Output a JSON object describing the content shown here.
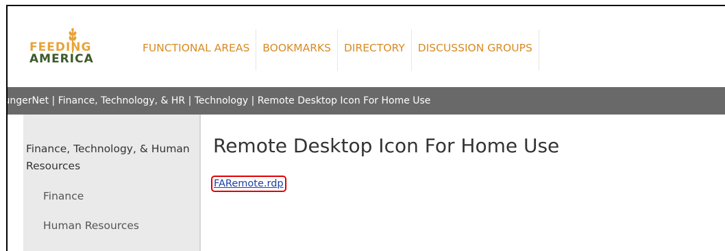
{
  "logo": {
    "line1": "FEEDING",
    "line2": "AMERICA",
    "icon": "wheat-icon"
  },
  "nav": {
    "items": [
      {
        "label": "FUNCTIONAL AREAS"
      },
      {
        "label": "BOOKMARKS"
      },
      {
        "label": "DIRECTORY"
      },
      {
        "label": "DISCUSSION GROUPS"
      }
    ]
  },
  "breadcrumb": {
    "text": "HungerNet | Finance, Technology, & HR | Technology | Remote Desktop Icon For Home Use"
  },
  "sidebar": {
    "heading": "Finance, Technology, & Human Resources",
    "items": [
      {
        "label": "Finance"
      },
      {
        "label": "Human Resources"
      }
    ]
  },
  "main": {
    "title": "Remote Desktop Icon For Home Use",
    "link_label": "FARemote.rdp"
  },
  "colors": {
    "nav_text": "#d98a22",
    "breadcrumb_bg": "#696969",
    "sidebar_bg": "#eaeaea",
    "link": "#1a3fa8",
    "highlight": "#e00000",
    "logo_orange": "#e8a33a",
    "logo_green": "#3d5a2a"
  }
}
